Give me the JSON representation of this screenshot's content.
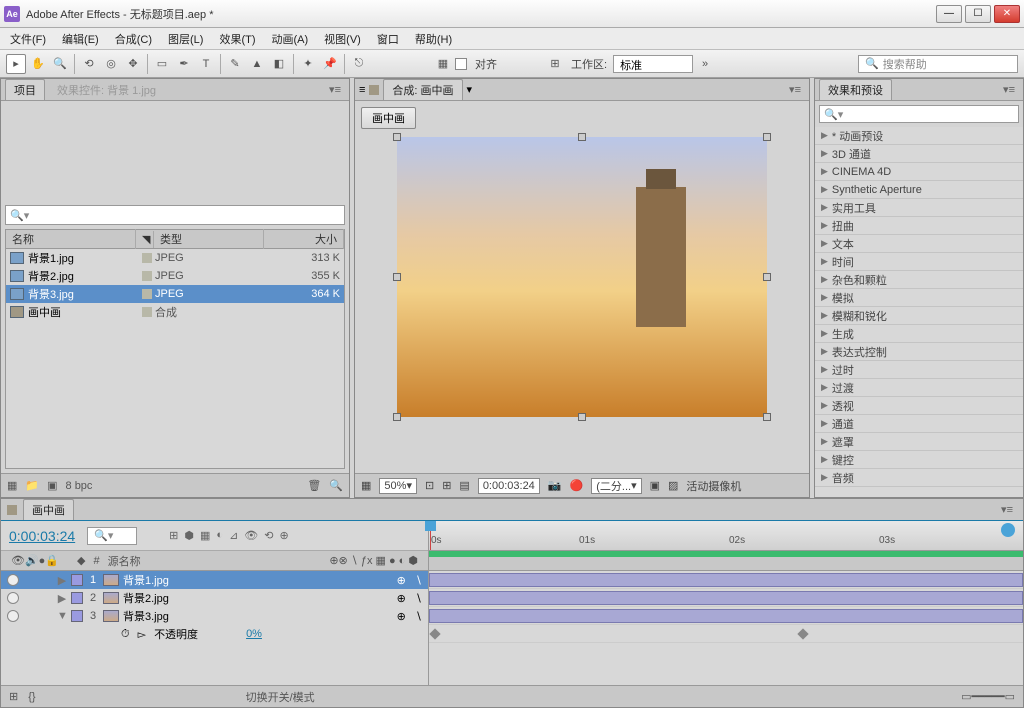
{
  "titlebar": {
    "app": "Adobe After Effects",
    "project": "无标题项目.aep *"
  },
  "menu": [
    "文件(F)",
    "编辑(E)",
    "合成(C)",
    "图层(L)",
    "效果(T)",
    "动画(A)",
    "视图(V)",
    "窗口",
    "帮助(H)"
  ],
  "toolbar": {
    "align_label": "对齐",
    "workspace_label": "工作区:",
    "workspace_value": "标准",
    "search_placeholder": "搜索帮助"
  },
  "project": {
    "tab_project": "项目",
    "tab_effects": "效果控件: 背景 1.jpg",
    "search_placeholder": "",
    "col_name": "名称",
    "col_type": "类型",
    "col_size": "大小",
    "items": [
      {
        "name": "背景1.jpg",
        "type": "JPEG",
        "size": "313 K",
        "kind": "img"
      },
      {
        "name": "背景2.jpg",
        "type": "JPEG",
        "size": "355 K",
        "kind": "img"
      },
      {
        "name": "背景3.jpg",
        "type": "JPEG",
        "size": "364 K",
        "kind": "img",
        "selected": true
      },
      {
        "name": "画中画",
        "type": "合成",
        "size": "",
        "kind": "comp"
      }
    ],
    "bpc": "8 bpc"
  },
  "composition": {
    "tab_label": "合成: 画中画",
    "button": "画中画",
    "footer": {
      "zoom": "50%",
      "time": "0:00:03:24",
      "res": "(二分...",
      "cam": "活动摄像机"
    }
  },
  "effects": {
    "tab": "效果和预设",
    "items": [
      "* 动画预设",
      "3D 通道",
      "CINEMA 4D",
      "Synthetic Aperture",
      "实用工具",
      "扭曲",
      "文本",
      "时间",
      "杂色和颗粒",
      "模拟",
      "模糊和锐化",
      "生成",
      "表达式控制",
      "过时",
      "过渡",
      "透视",
      "通道",
      "遮罩",
      "键控",
      "音频"
    ]
  },
  "timeline": {
    "tab": "画中画",
    "current_time": "0:00:03:24",
    "col_source": "源名称",
    "layers": [
      {
        "n": "1",
        "name": "背景1.jpg",
        "selected": true
      },
      {
        "n": "2",
        "name": "背景2.jpg"
      },
      {
        "n": "3",
        "name": "背景3.jpg"
      }
    ],
    "opacity_label": "不透明度",
    "opacity_value": "0%",
    "ruler": [
      "0s",
      "01s",
      "02s",
      "03s"
    ],
    "switch_label": "切换开关/模式"
  }
}
